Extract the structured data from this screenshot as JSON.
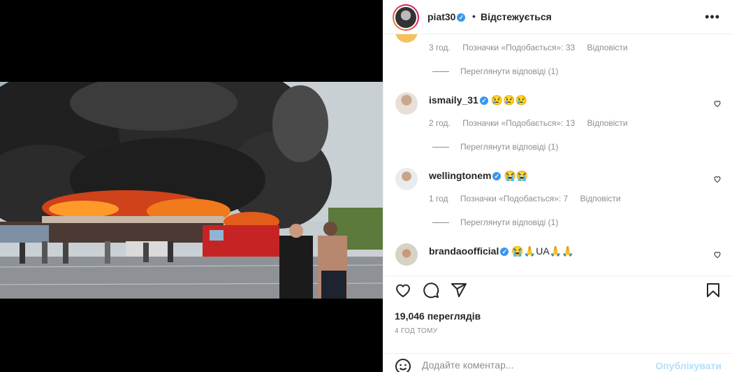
{
  "post": {
    "username": "piat30",
    "separator": "•",
    "follow_status": "Відстежується",
    "more_icon": "more-horizontal-icon"
  },
  "comments": [
    {
      "username": "",
      "text": "",
      "time": "3 год.",
      "likes": "Позначки «Подобається»: 33",
      "reply": "Відповісти",
      "view_replies": "Переглянути відповіді (1)"
    },
    {
      "username": "ismaily_31",
      "text": "😢😢😢",
      "time": "2 год.",
      "likes": "Позначки «Подобається»: 13",
      "reply": "Відповісти",
      "view_replies": "Переглянути відповіді (1)"
    },
    {
      "username": "wellingtonem",
      "text": "😭😭",
      "time": "1 год",
      "likes": "Позначки «Подобається»: 7",
      "reply": "Відповісти",
      "view_replies": "Переглянути відповіді (1)"
    },
    {
      "username": "brandaoofficial",
      "text": "😭🙏UA🙏🙏",
      "time": "",
      "likes": "",
      "reply": "",
      "view_replies": ""
    }
  ],
  "stats": {
    "views": "19,046 переглядів",
    "posted": "4 ГОД ТОМУ"
  },
  "composer": {
    "placeholder": "Додайте коментар...",
    "publish_label": "Опублікувати"
  },
  "colors": {
    "accent": "#0095f6",
    "publish_disabled": "#b2dffc",
    "verified": "#3897f0",
    "muted_text": "#8e8e8e"
  }
}
